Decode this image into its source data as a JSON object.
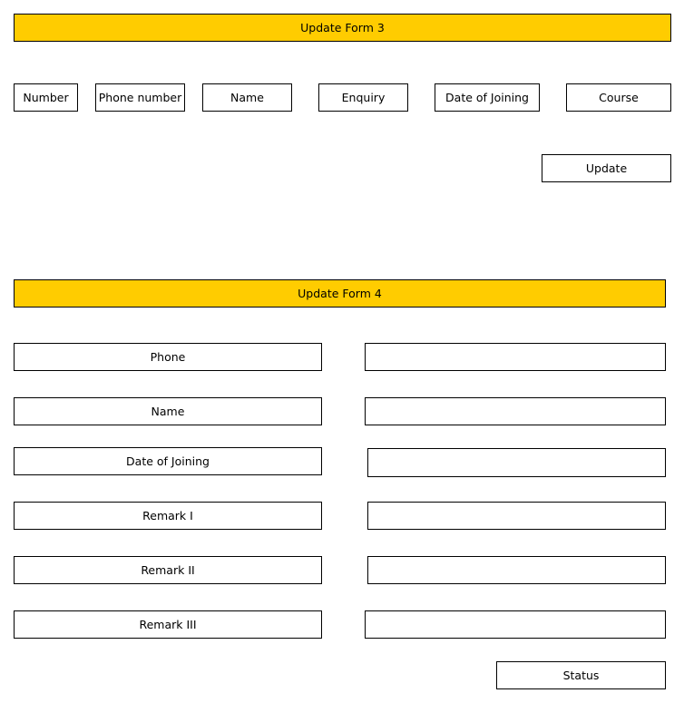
{
  "form3": {
    "title": "Update Form 3",
    "fields": [
      "Number",
      "Phone number",
      "Name",
      "Enquiry",
      "Date of Joining",
      "Course"
    ],
    "button": "Update"
  },
  "form4": {
    "title": "Update Form 4",
    "labels": [
      "Phone",
      "Name",
      "Date of Joining",
      "Remark I",
      "Remark II",
      "Remark III"
    ],
    "inputs": [
      "",
      "",
      "",
      "",
      "",
      ""
    ],
    "button": "Status"
  },
  "colors": {
    "header_fill": "#ffcc00",
    "border": "#000000",
    "background": "#ffffff"
  }
}
